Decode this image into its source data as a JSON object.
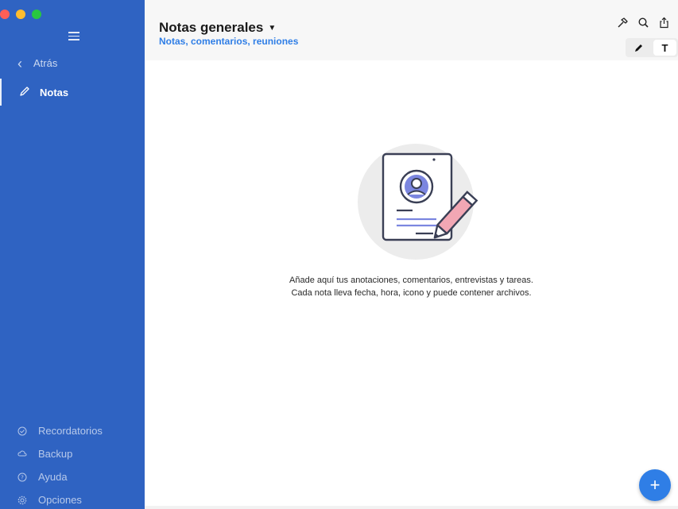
{
  "window": {
    "traffic_colors": [
      "#ff5f57",
      "#febc2e",
      "#28c840"
    ]
  },
  "sidebar": {
    "menu_icon": "hamburger-icon",
    "back_label": "Atrás",
    "active_item": {
      "label": "Notas",
      "icon": "pencil-icon"
    },
    "bottom_items": [
      {
        "label": "Recordatorios",
        "icon": "check-circle-icon"
      },
      {
        "label": "Backup",
        "icon": "cloud-icon"
      },
      {
        "label": "Ayuda",
        "icon": "help-icon"
      },
      {
        "label": "Opciones",
        "icon": "gear-icon"
      }
    ],
    "color": "#2f63c2"
  },
  "header": {
    "title": "Notas generales",
    "subtitle": "Notas, comentarios, reuniones",
    "tools": [
      "hammer-icon",
      "search-icon",
      "share-icon"
    ],
    "mode_text_label": "T"
  },
  "empty_state": {
    "line1": "Añade aquí tus anotaciones, comentarios, entrevistas y tareas.",
    "line2": "Cada nota lleva fecha, hora, icono y puede contener archivos."
  },
  "fab": {
    "label": "+"
  },
  "colors": {
    "accent": "#2f7ee6",
    "sidebar": "#2f63c2"
  }
}
